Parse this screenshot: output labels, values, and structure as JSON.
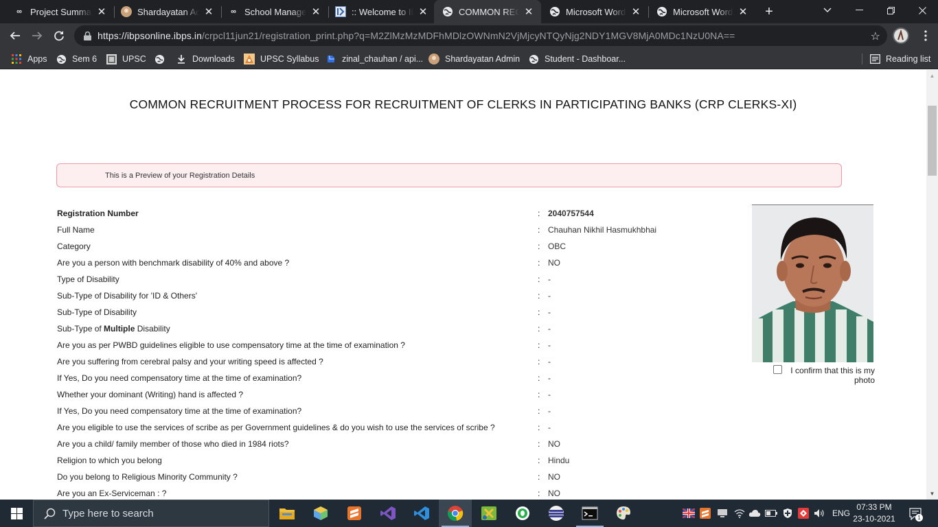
{
  "browser": {
    "tabs": [
      {
        "title": "Project Summary",
        "favicon": "infinity-icon"
      },
      {
        "title": "Shardayatan Admin",
        "favicon": "avatar-icon"
      },
      {
        "title": "School Management",
        "favicon": "infinity-icon"
      },
      {
        "title": ":: Welcome to IBPS",
        "favicon": "ibps-icon"
      },
      {
        "title": "COMMON RECRUITMENT",
        "favicon": "globe-icon",
        "active": true
      },
      {
        "title": "Microsoft Word - ",
        "favicon": "globe-icon"
      },
      {
        "title": "Microsoft Word - ",
        "favicon": "globe-icon"
      }
    ],
    "new_tab_label": "+",
    "url_host": "https://ibpsonline.ibps.in",
    "url_path": "/crpcl11jun21/registration_print.php?q=M2ZlMzMzMDFhMDlzOWNmN2VjMjcyNTQyNjg2NDY1MGV8MjA0MDc1NzU0NA==",
    "bookmarks": [
      {
        "label": "Apps",
        "icon": "apps-grid-icon"
      },
      {
        "label": "Sem 6",
        "icon": "globe-icon"
      },
      {
        "label": "UPSC",
        "icon": "upsc-icon"
      },
      {
        "label": "",
        "icon": "globe-icon"
      },
      {
        "label": "Downloads",
        "icon": "download-icon"
      },
      {
        "label": "UPSC Syllabus",
        "icon": "syllabus-icon"
      },
      {
        "label": "zinal_chauhan / api...",
        "icon": "code-icon"
      },
      {
        "label": "Shardayatan Admin",
        "icon": "avatar-icon"
      },
      {
        "label": "Student - Dashboar...",
        "icon": "globe-icon"
      }
    ],
    "reading_list_label": "Reading list"
  },
  "page": {
    "title": "COMMON RECRUITMENT PROCESS FOR RECRUITMENT OF CLERKS IN PARTICIPATING BANKS (CRP CLERKS-XI)",
    "preview_notice": "This is a Preview of your Registration Details",
    "fields": [
      {
        "label": "Registration Number",
        "value": "2040757544"
      },
      {
        "label": "Full Name",
        "value": "Chauhan Nikhil Hasmukhbhai"
      },
      {
        "label": "Category",
        "value": "OBC"
      },
      {
        "label": "Are you a person with benchmark disability of 40% and above ?",
        "value": "NO"
      },
      {
        "label": "Type of Disability",
        "value": "-"
      },
      {
        "label": "Sub-Type of Disability for 'ID & Others'",
        "value": "-"
      },
      {
        "label": "Sub-Type of Disability",
        "value": "-"
      },
      {
        "label_prefix": "Sub-Type of ",
        "label_bold": "Multiple",
        "label_suffix": " Disability",
        "value": "-"
      },
      {
        "label": "Are you as per PWBD guidelines eligible to use compensatory time at the time of examination ?",
        "value": "-"
      },
      {
        "label": "Are you suffering from cerebral palsy and your writing speed is affected ?",
        "value": "-"
      },
      {
        "label": "If Yes, Do you need compensatory time at the time of examination?",
        "value": "-"
      },
      {
        "label": "Whether your dominant (Writing) hand is affected ?",
        "value": "-"
      },
      {
        "label": "If Yes, Do you need compensatory time at the time of examination?",
        "value": "-"
      },
      {
        "label": "Are you eligible to use the services of scribe as per Government guidelines & do you wish to use the services of scribe ?",
        "value": "-"
      },
      {
        "label": "Are you a child/ family member of those who died in 1984 riots?",
        "value": "NO"
      },
      {
        "label": "Religion to which you belong",
        "value": "Hindu"
      },
      {
        "label": "Do you belong to Religious Minority Community ?",
        "value": "NO"
      },
      {
        "label": "Are you an Ex-Serviceman : ?",
        "value": "NO"
      }
    ],
    "separator": ":",
    "photo_confirm_line1": "I confirm that this is my",
    "photo_confirm_line2": "photo"
  },
  "taskbar": {
    "search_placeholder": "Type here to search",
    "apps": [
      "file-explorer-icon",
      "box-3d-icon",
      "sublime-icon",
      "visual-studio-icon",
      "vscode-icon",
      "chrome-icon",
      "snip-icon",
      "whatsapp-icon",
      "globe-stripes-icon",
      "terminal-icon",
      "paint-icon"
    ],
    "language": "ENG",
    "time": "07:33 PM",
    "date": "23-10-2021",
    "notification_count": "1"
  },
  "colors": {
    "tab_strip_bg": "#202124",
    "toolbar_bg": "#35363a",
    "preview_box_bg": "#fdeef0",
    "preview_box_border": "#e99aa6",
    "taskbar_bg": "#1f2a35"
  }
}
